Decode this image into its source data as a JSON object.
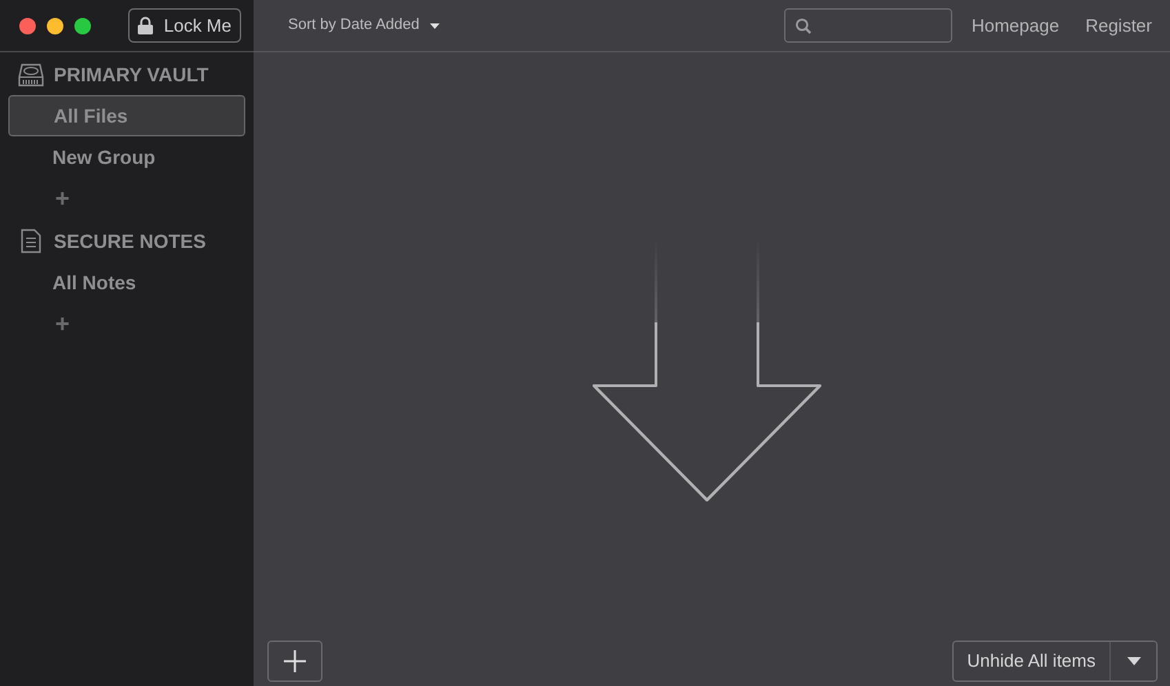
{
  "toolbar": {
    "lock_button": "Lock Me",
    "sort_menu": "Sort by Date Added",
    "links": [
      "Homepage",
      "Register"
    ]
  },
  "sidebar": {
    "sections": [
      {
        "kind": "vault",
        "title": "PRIMARY VAULT",
        "items": [
          {
            "label": "All Files",
            "selected": true
          },
          {
            "label": "New Group",
            "selected": false
          }
        ],
        "add": "+"
      },
      {
        "kind": "notes",
        "title": "SECURE NOTES",
        "items": [
          {
            "label": "All Notes",
            "selected": false
          }
        ],
        "add": "+"
      }
    ]
  },
  "footer": {
    "unhide_button": "Unhide All items"
  }
}
